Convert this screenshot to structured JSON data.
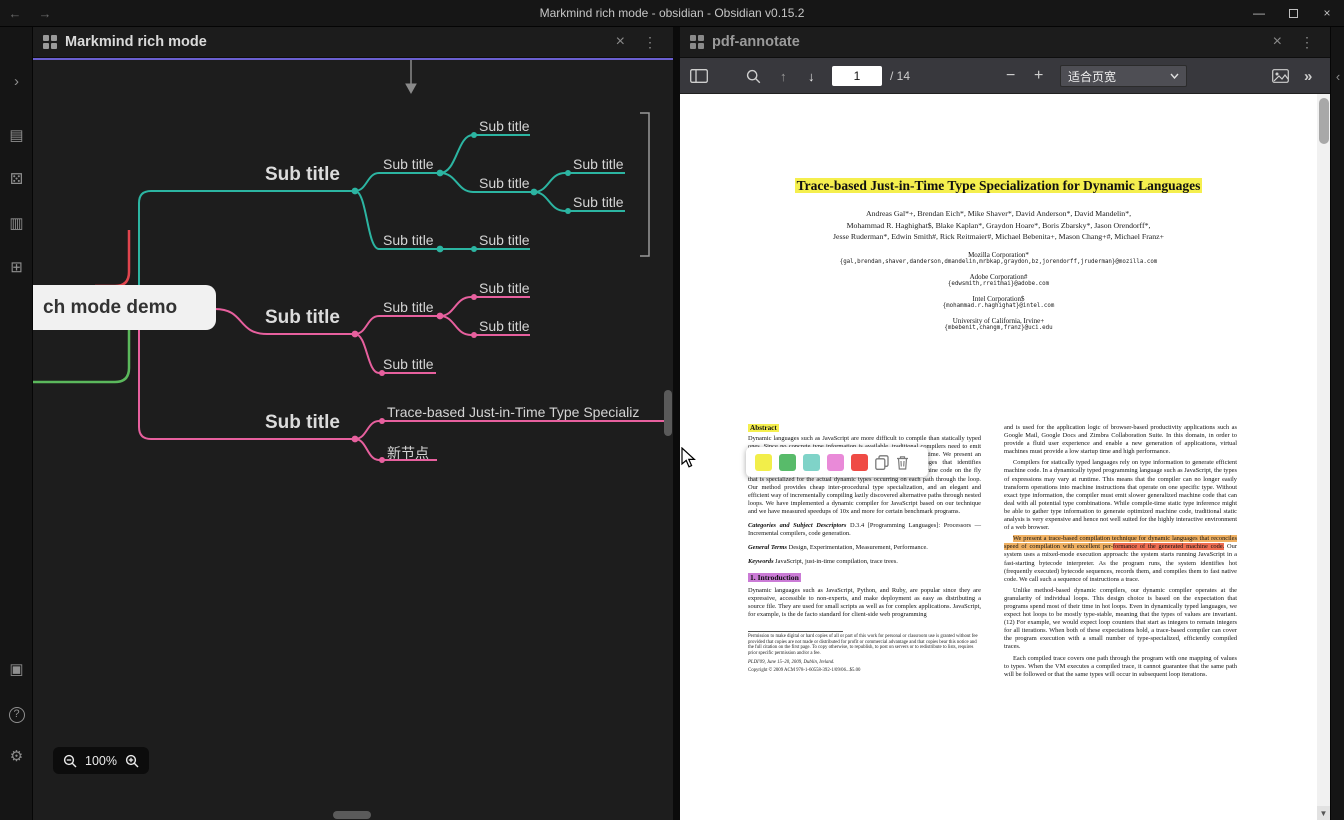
{
  "titlebar": {
    "back_glyph": "←",
    "forward_glyph": "→",
    "title": "Markmind rich mode - obsidian - Obsidian v0.15.2",
    "minimize_glyph": "—",
    "close_glyph": "×"
  },
  "ribbon": {
    "icons": [
      {
        "name": "expand-sidebar-icon",
        "glyph": "›"
      },
      {
        "name": "markmind-note-icon",
        "glyph": "▤"
      },
      {
        "name": "random-note-icon",
        "glyph": "⚄"
      },
      {
        "name": "rich-mode-icon",
        "glyph": "▥"
      },
      {
        "name": "grid-view-icon",
        "glyph": "⊞"
      },
      {
        "name": "export-image-icon",
        "glyph": "▣"
      },
      {
        "name": "help-icon",
        "glyph": "?"
      },
      {
        "name": "settings-icon",
        "glyph": "⚙"
      }
    ]
  },
  "left_pane": {
    "tab": {
      "title": "Markmind rich mode",
      "close_glyph": "×",
      "more_glyph": "⋮"
    },
    "mindmap": {
      "root": "ch mode demo",
      "nodes": [
        "Sub title",
        "Sub title",
        "Sub title",
        "Sub title",
        "Sub title",
        "Sub title",
        "Sub title",
        "Sub title",
        "Sub title",
        "Sub title",
        "Sub title",
        "Sub title",
        "Sub title",
        "Sub title",
        "Trace-based Just-in-Time Type Specializ",
        "新节点"
      ],
      "zoom_level": "100%"
    }
  },
  "right_pane": {
    "tab": {
      "title": "pdf-annotate",
      "close_glyph": "×",
      "more_glyph": "⋮"
    },
    "toolbar": {
      "page_value": "1",
      "page_total": "/ 14",
      "find_prev_glyph": "↑",
      "find_next_glyph": "↓",
      "zoom_out_glyph": "−",
      "zoom_in_glyph": "+",
      "fit_mode": "适合页宽",
      "more_tools_glyph": "»"
    },
    "annotation_toolbar": {
      "swatch_styles": [
        "background:#f2ee4a",
        "background:#58bb6a",
        "background:#7fd3c8",
        "background:#e98ad8",
        "background:#ef4b45"
      ]
    },
    "pdf": {
      "title": "Trace-based Just-in-Time Type Specialization for Dynamic Languages",
      "authors": [
        "Andreas Gal*+, Brendan Eich*, Mike Shaver*, David Anderson*, David Mandelin*,",
        "Mohammad R. Haghighat$, Blake Kaplan*, Graydon Hoare*, Boris Zbarsky*, Jason Orendorff*,",
        "Jesse Ruderman*, Edwin Smith#, Rick Reitmaier#, Michael Bebenita+, Mason Chang+#, Michael Franz+"
      ],
      "affiliations": [
        {
          "name": "Mozilla Corporation*",
          "email": "{gal,brendan,shaver,danderson,dmandelin,mrbkap,graydon,bz,jorendorff,jruderman}@mozilla.com"
        },
        {
          "name": "Adobe Corporation#",
          "email": "{edwsmith,rreitmai}@adobe.com"
        },
        {
          "name": "Intel Corporation$",
          "email": "{mohammad.r.haghighat}@intel.com"
        },
        {
          "name": "University of California, Irvine+",
          "email": "{mbebenit,changm,franz}@uci.edu"
        }
      ],
      "abstract_label": "Abstract",
      "abstract_text": "Dynamic languages such as JavaScript are more difficult to compile than statically typed ones. Since no concrete type information is available, traditional compilers need to emit generic code that can handle all possible type combinations at runtime. We present an alternative compilation technique for dynamically-typed languages that identifies frequently executed loop traces at run-time and then generates machine code on the fly that is specialized for the actual dynamic types occurring on each path through the loop. Our method provides cheap inter-procedural type specialization, and an elegant and efficient way of incrementally compiling lazily discovered alternative paths through nested loops. We have implemented a dynamic compiler for JavaScript based on our technique and we have measured speedups of 10x and more for certain benchmark programs.",
      "categories_label": "Categories and Subject Descriptors",
      "categories_text": "  D.3.4 [Programming Languages]: Processors — Incremental compilers, code generation.",
      "general_label": "General Terms",
      "general_text": "  Design, Experimentation, Measurement, Performance.",
      "keywords_label": "Keywords",
      "keywords_text": "  JavaScript, just-in-time compilation, trace trees.",
      "intro_heading": "1.   Introduction",
      "intro_text": "Dynamic languages such as JavaScript, Python, and Ruby, are popular since they are expressive, accessible to non-experts, and make deployment as easy as distributing a source file. They are used for small scripts as well as for complex applications. JavaScript, for example, is the de facto standard for client-side web programming",
      "footnote": "Permission to make digital or hard copies of all or part of this work for personal or classroom use is granted without fee provided that copies are not made or distributed for profit or commercial advantage and that copies bear this notice and the full citation on the first page. To copy otherwise, to republish, to post on servers or to redistribute to lists, requires prior specific permission and/or a fee.",
      "conf_line": "PLDI'09,  June 15–20, 2009, Dublin, Ireland.",
      "copyright_line": "Copyright © 2009 ACM 978-1-60558-392-1/09/06...$5.00",
      "col2_p1": "and is used for the application logic of browser-based productivity applications such as Google Mail, Google Docs and Zimbra Collaboration Suite. In this domain, in order to provide a fluid user experience and enable a new generation of applications, virtual machines must provide a low startup time and high performance.",
      "col2_p2": "Compilers for statically typed languages rely on type information to generate efficient machine code. In a dynamically typed programming language such as JavaScript, the types of expressions may vary at runtime. This means that the compiler can no longer easily transform operations into machine instructions that operate on one specific type. Without exact type information, the compiler must emit slower generalized machine code that can deal with all potential type combinations. While compile-time static type inference might be able to gather type information to generate optimized machine code, traditional static analysis is very expensive and hence not well suited for the highly interactive environment of a web browser.",
      "hl1": "We present a trace-based compilation technique for dynamic languages that reconciles speed of compilation with excellent per-",
      "hl2": "formance of the generated machine code.",
      "col2_p3_rest": " Our system uses a mixed-mode execution approach: the system starts running JavaScript in a fast-starting bytecode interpreter. As the program runs, the system identifies hot (frequently executed) bytecode sequences, records them, and compiles them to fast native code. We call such a sequence of instructions a trace.",
      "col2_p4": "Unlike method-based dynamic compilers, our dynamic compiler operates at the granularity of individual loops. This design choice is based on the expectation that programs spend most of their time in hot loops. Even in dynamically typed languages, we expect hot loops to be mostly type-stable, meaning that the types of values are invariant. (12) For example, we would expect loop counters that start as integers to remain integers for all iterations. When both of these expectations hold, a trace-based compiler can cover the program execution with a small number of type-specialized, efficiently compiled traces.",
      "col2_p5": "Each compiled trace covers one path through the program with one mapping of values to types. When the VM executes a compiled trace, it cannot guarantee that the same path will be followed or that the same types will occur in subsequent loop iterations."
    }
  },
  "right_sidebar": {
    "collapse_glyph": "‹"
  },
  "colors": {
    "accent_active_pane": "#6a5fd0",
    "branch_teal": "#2cb5a2",
    "branch_pink": "#e7609e",
    "branch_red": "#e0454e",
    "branch_green": "#5bb85c",
    "title_highlight": "#f5ef4e",
    "intro_highlight": "#cb7bd6",
    "sentence_highlight": "#f0b163",
    "sentence_highlight_strong": "#ee6d52"
  }
}
